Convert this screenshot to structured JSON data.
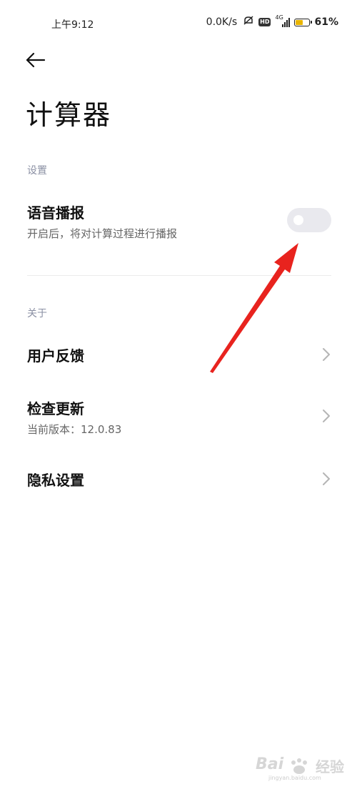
{
  "status_bar": {
    "time": "上午9:12",
    "net_speed": "0.0K/s",
    "hd_badge": "HD",
    "network_gen": "4G",
    "battery_percent": 0.61,
    "battery_label": "61%"
  },
  "header": {
    "title": "计算器"
  },
  "settings_section": {
    "label": "设置",
    "voice_broadcast": {
      "title": "语音播报",
      "subtitle": "开启后，将对计算过程进行播报",
      "enabled": false
    }
  },
  "about_section": {
    "label": "关于",
    "items": [
      {
        "title": "用户反馈"
      },
      {
        "title": "检查更新",
        "subtitle": "当前版本：12.0.83"
      },
      {
        "title": "隐私设置"
      }
    ]
  },
  "watermark": {
    "brand": "Bai",
    "brand_suffix": "经验",
    "url": "jingyan.baidu.com"
  },
  "colors": {
    "annotation_arrow": "#e8231e",
    "toggle_off": "#e9e9ee",
    "section_label": "#8a8fa3",
    "battery_fill": "#e8b400"
  }
}
